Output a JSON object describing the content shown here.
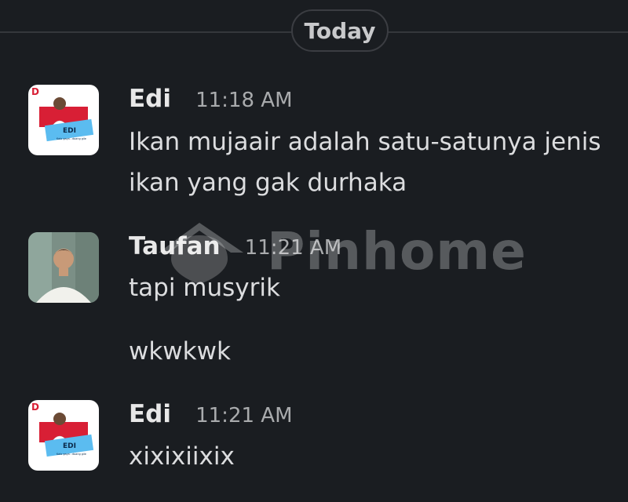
{
  "divider": {
    "label": "Today"
  },
  "watermark": {
    "text": "Pinhome"
  },
  "messages": [
    {
      "sender": "Edi",
      "time": "11:18 AM",
      "lines": [
        "Ikan mujaair adalah satu-satunya jenis",
        "ikan yang gak durhaka"
      ],
      "avatar_text": "EDI",
      "avatar_subtext": "Kalo gaya - doang gile",
      "avatar_logo_letter": "D"
    },
    {
      "sender": "Taufan",
      "time": "11:21 AM",
      "lines": [
        "tapi musyrik",
        "wkwkwk"
      ]
    },
    {
      "sender": "Edi",
      "time": "11:21 AM",
      "lines": [
        "xixixiixix"
      ],
      "avatar_text": "EDI",
      "avatar_subtext": "Kalo gaya - doang gile",
      "avatar_logo_letter": "D"
    }
  ],
  "colors": {
    "background": "#1a1d21",
    "avatar_red": "#d81f35",
    "avatar_blue": "#5bbcf0"
  }
}
